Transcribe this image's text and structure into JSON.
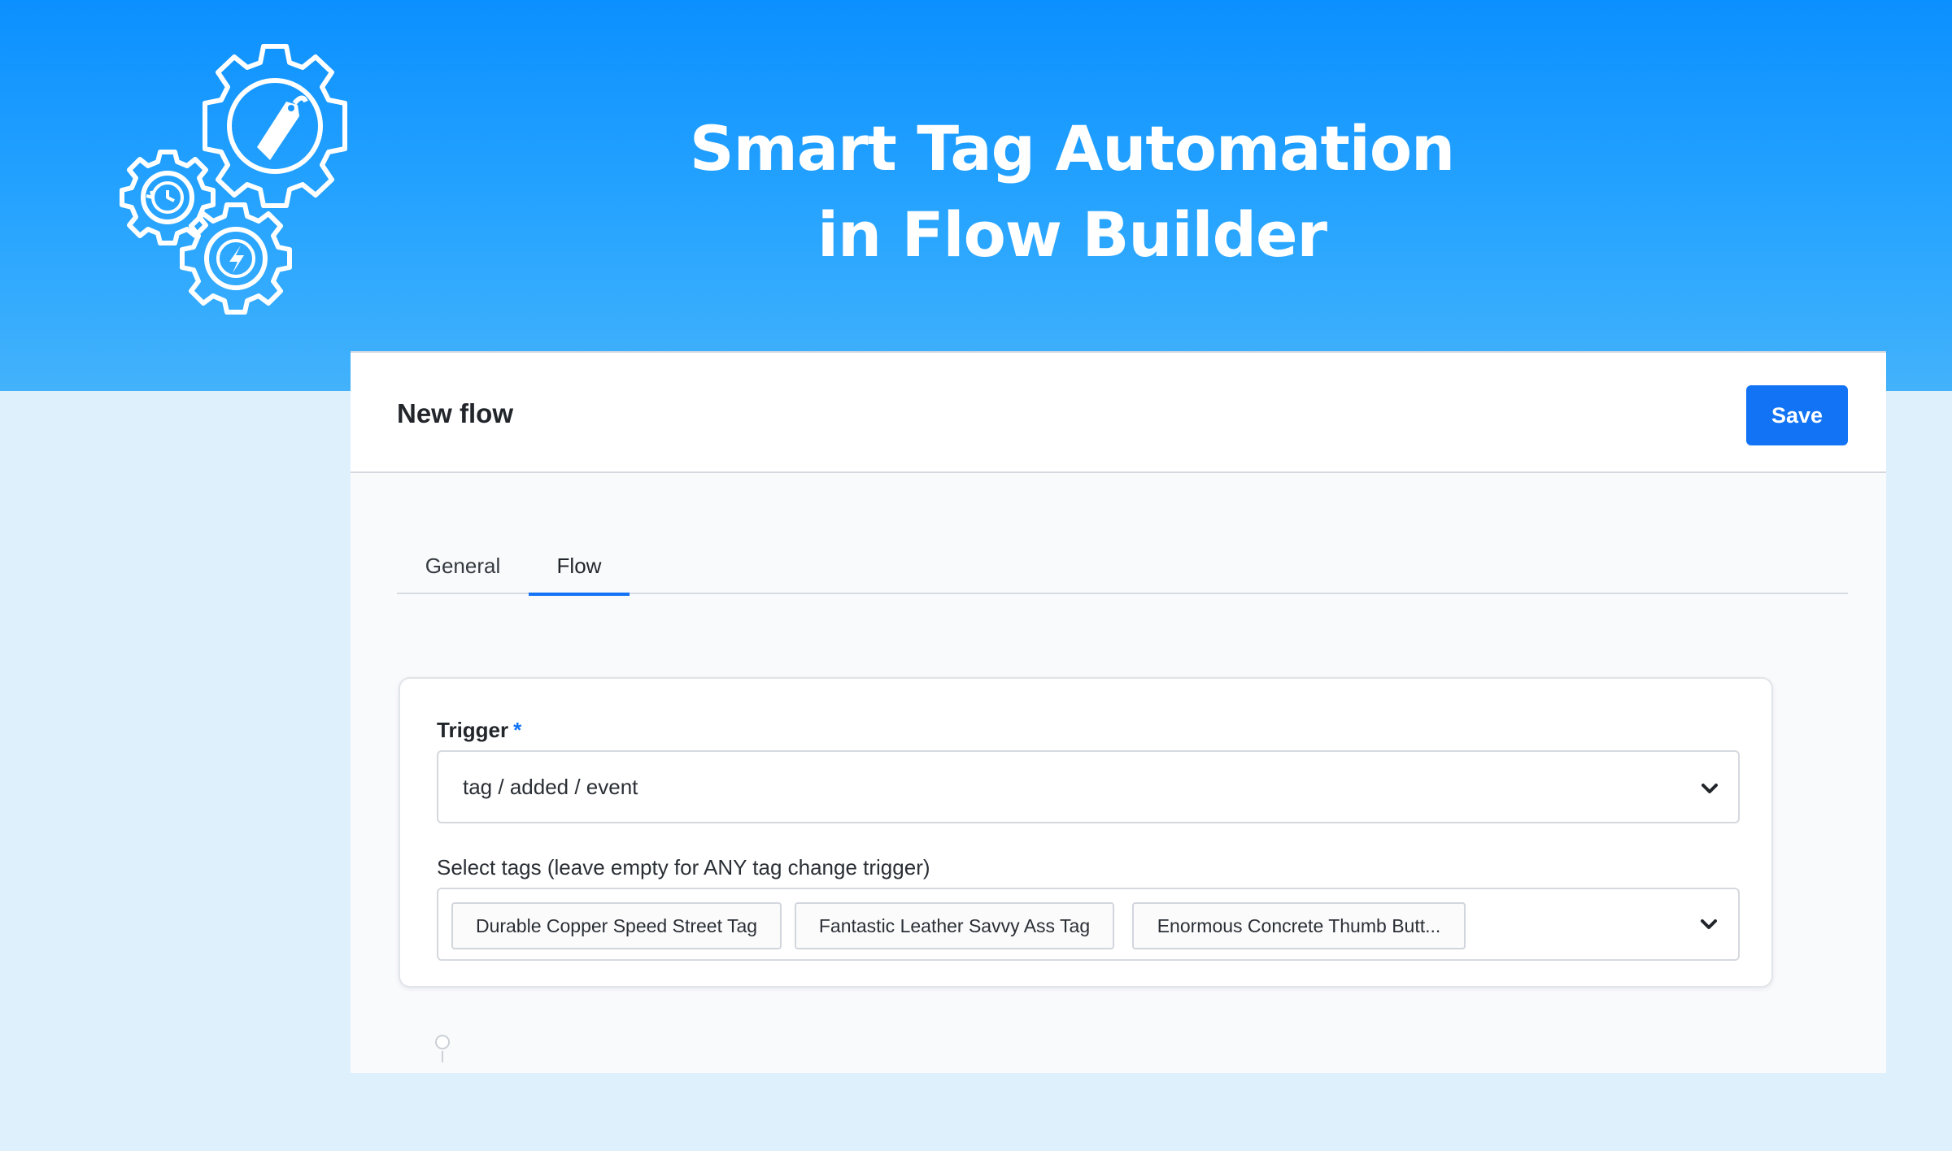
{
  "hero": {
    "title_line1": "Smart Tag Automation",
    "title_line2": "in Flow Builder",
    "logo_icons": [
      "gear-tag-icon",
      "gear-history-icon",
      "gear-lightning-icon"
    ]
  },
  "header": {
    "title": "New flow",
    "save_label": "Save"
  },
  "tabs": [
    {
      "label": "General",
      "active": false
    },
    {
      "label": "Flow",
      "active": true
    }
  ],
  "form": {
    "trigger_label": "Trigger",
    "required_mark": "*",
    "trigger_value": "tag / added / event",
    "tags_label": "Select tags (leave empty for ANY tag change trigger)",
    "selected_tags": [
      "Durable Copper Speed Street Tag",
      "Fantastic Leather Savvy Ass Tag",
      "Enormous Concrete Thumb Butt..."
    ]
  },
  "colors": {
    "accent": "#1273f5",
    "hero_blue": "#0b90ff",
    "background": "#dff0fd"
  }
}
